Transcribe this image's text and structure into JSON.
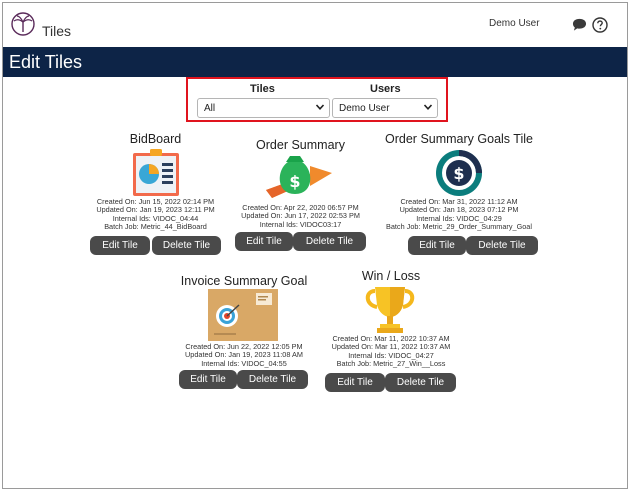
{
  "app": {
    "title": "Tiles",
    "user": "Demo User"
  },
  "page": {
    "title": "Edit Tiles"
  },
  "filters": {
    "tiles_label": "Tiles",
    "tiles_value": "All",
    "users_label": "Users",
    "users_value": "Demo User"
  },
  "colors": {
    "navbar": "#0d2447",
    "button": "#4a4a4a",
    "highlight": "#e0141e"
  },
  "tiles": [
    {
      "name": "BidBoard",
      "icon": "bidboard-clipboard-chart-icon",
      "created": "Created On: Jun 15, 2022 02:14 PM",
      "updated": "Updated On: Jan 19, 2023 12:11 PM",
      "internal_ids": "Internal Ids: VIDOC_04:44",
      "batch_job": "Batch Job: Metric_44_BidBoard",
      "edit_label": "Edit Tile",
      "delete_label": "Delete Tile"
    },
    {
      "name": "Order Summary",
      "icon": "money-bag-arrow-icon",
      "created": "Created On: Apr 22, 2020 06:57 PM",
      "updated": "Updated On: Jun 17, 2022 02:53 PM",
      "internal_ids": "Internal Ids: VIDOC03:17",
      "edit_label": "Edit Tile",
      "delete_label": "Delete Tile"
    },
    {
      "name": "Order Summary Goals Tile",
      "icon": "dollar-coin-gauge-icon",
      "created": "Created On: Mar 31, 2022 11:12 AM",
      "updated": "Updated On: Jan 18, 2023 07:12 PM",
      "internal_ids": "Internal Ids: VIDOC_04:29",
      "batch_job": "Batch Job: Metric_29_Order_Summary_Goal",
      "edit_label": "Edit Tile",
      "delete_label": "Delete Tile"
    },
    {
      "name": "Invoice Summary Goal",
      "icon": "target-envelope-icon",
      "created": "Created On: Jun 22, 2022 12:05 PM",
      "updated": "Updated On: Jan 19, 2023 11:08 AM",
      "internal_ids": "Internal Ids: VIDOC_04:55",
      "edit_label": "Edit Tile",
      "delete_label": "Delete Tile"
    },
    {
      "name": "Win / Loss",
      "icon": "trophy-icon",
      "created": "Created On: Mar 11, 2022 10:37 AM",
      "updated": "Updated On: Mar 11, 2022 10:37 AM",
      "internal_ids": "Internal Ids: VIDOC_04:27",
      "batch_job": "Batch Job: Metric_27_Win__Loss",
      "edit_label": "Edit Tile",
      "delete_label": "Delete Tile"
    }
  ]
}
